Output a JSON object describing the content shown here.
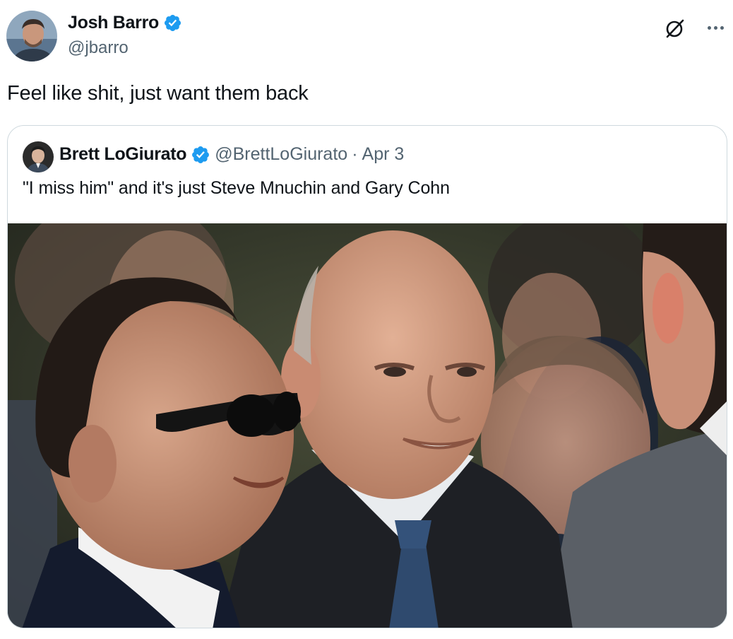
{
  "tweet": {
    "author_name": "Josh Barro",
    "author_handle": "@jbarro",
    "verified": true,
    "text": "Feel like shit, just want them back",
    "icons": [
      "grok-icon",
      "more-icon"
    ]
  },
  "quoted_tweet": {
    "author_name": "Brett LoGiurato",
    "author_handle": "@BrettLoGiurato",
    "separator": "·",
    "date": "Apr 3",
    "verified": true,
    "text": "\"I miss him\" and it's just Steve Mnuchin and Gary Cohn"
  },
  "colors": {
    "verified_blue": "#1d9bf0",
    "text_primary": "#0f1419",
    "text_secondary": "#536471",
    "border": "#cfd9de"
  }
}
